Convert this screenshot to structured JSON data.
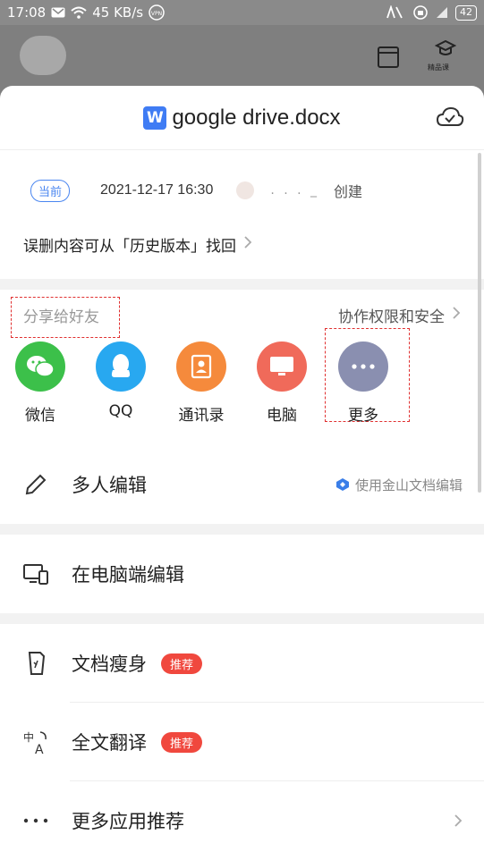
{
  "status_bar": {
    "time": "17:08",
    "net_speed": "45 KB/s",
    "vpn_label": "VPN",
    "battery": "42"
  },
  "app_bar": {
    "premium_course_label": "精品课"
  },
  "document": {
    "icon_letter": "W",
    "title": "google drive.docx"
  },
  "version": {
    "badge": "当前",
    "timestamp": "2021-12-17 16:30",
    "author_name": ". . . _",
    "created_label": "创建"
  },
  "history": {
    "text": "误删内容可从「历史版本」找回"
  },
  "share": {
    "title": "分享给好友",
    "permission_link": "协作权限和安全",
    "targets": [
      {
        "label": "微信",
        "color": "#3cc04a"
      },
      {
        "label": "QQ",
        "color": "#28a8f0"
      },
      {
        "label": "通讯录",
        "color": "#f58a3c"
      },
      {
        "label": "电脑",
        "color": "#f06a5a"
      },
      {
        "label": "更多",
        "color": "#8a8fb0"
      }
    ]
  },
  "menu": {
    "multi_edit": {
      "label": "多人编辑",
      "right_text": "使用金山文档编辑"
    },
    "pc_edit": {
      "label": "在电脑端编辑"
    },
    "slim": {
      "label": "文档瘦身",
      "badge": "推荐"
    },
    "translate": {
      "label": "全文翻译",
      "badge": "推荐"
    },
    "more_apps": {
      "label": "更多应用推荐"
    }
  },
  "colors": {
    "accent_blue": "#3f7cf4",
    "recommend_red": "#f0483e",
    "highlight_dash": "#e03030"
  }
}
